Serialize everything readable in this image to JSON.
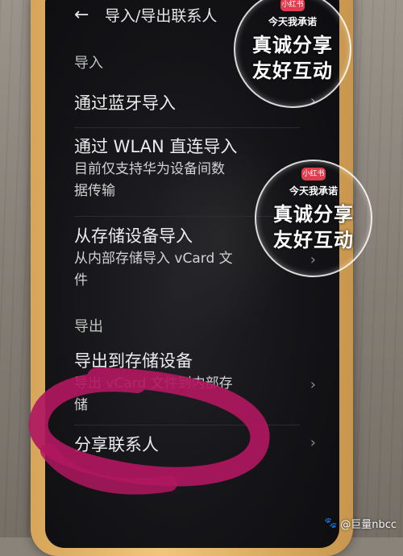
{
  "header": {
    "title": "导入/导出联系人",
    "back_icon": "arrow-left-icon"
  },
  "sections": [
    {
      "label": "导入"
    },
    {
      "label": "导出"
    }
  ],
  "items": [
    {
      "title": "通过蓝牙导入",
      "subtitle": ""
    },
    {
      "title": "通过 WLAN 直连导入",
      "subtitle_line1": "目前仅支持华为设备间数",
      "subtitle_line2": "据传输"
    },
    {
      "title": "从存储设备导入",
      "subtitle_line1": "从内部存储导入 vCard 文",
      "subtitle_line2": "件"
    },
    {
      "title": "导出到存储设备",
      "subtitle_line1": "导出 vCard 文件到内部存",
      "subtitle_line2": "储"
    },
    {
      "title": "分享联系人",
      "subtitle": ""
    }
  ],
  "chevron_glyph": "›",
  "watermark": {
    "badge": "小红书",
    "line1": "今天我承诺",
    "line2": "真诚分享",
    "line3": "友好互动"
  },
  "credit": {
    "icon": "paw-icon",
    "text": "@巨量nbcc"
  },
  "colors": {
    "marker": "#b0185f",
    "stamp_badge": "#e33c4f",
    "phone_frame": "#e0b06a"
  }
}
